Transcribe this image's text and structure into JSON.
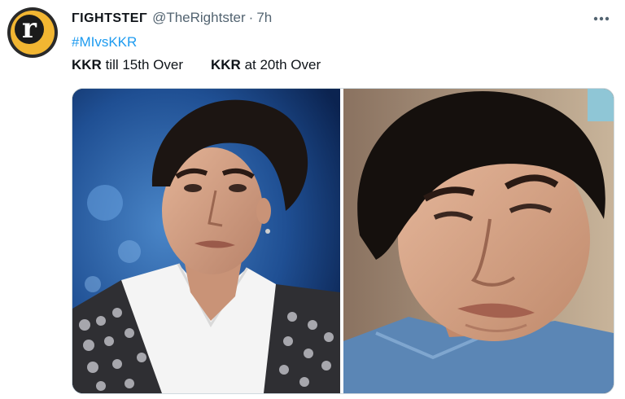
{
  "tweet": {
    "author_name": "ΓIGHTSTEΓ",
    "handle": "@TheRightster",
    "separator": "·",
    "time": "7h",
    "more_icon": "more-horizontal-icon",
    "hashtag": "#MIvsKKR",
    "caption": {
      "left_bold": "KKR",
      "left_rest": " till 15th Over",
      "right_bold": "KKR",
      "right_rest": " at 20th Over"
    }
  },
  "avatar": {
    "logo_letter": "r",
    "colors": {
      "ring": "#f2b632",
      "center": "#1b1b1b"
    }
  },
  "colors": {
    "link": "#1d9bf0",
    "secondary": "#536471",
    "text": "#0f1419"
  }
}
